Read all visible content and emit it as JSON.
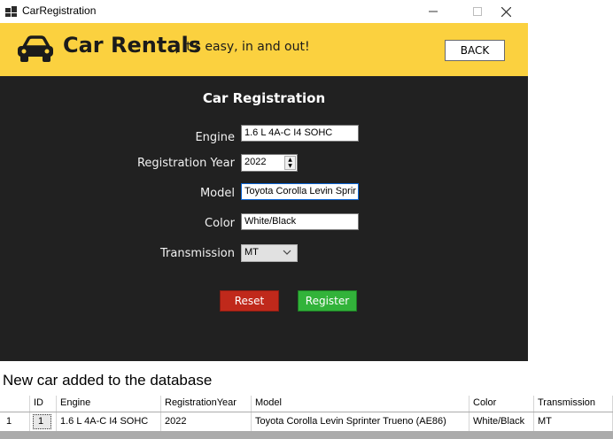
{
  "window": {
    "title": "CarRegistration",
    "controls": {
      "minimize": "minimize-icon",
      "maximize": "maximize-icon",
      "close": "close-icon"
    }
  },
  "banner": {
    "brand": "Car Rentals",
    "tagline": "| It's easy, in and out!",
    "back_label": "BACK",
    "color": "#fbd13f"
  },
  "form": {
    "title": "Car Registration",
    "engine": {
      "label": "Engine",
      "value": "1.6 L 4A-C I4 SOHC"
    },
    "year": {
      "label": "Registration Year",
      "value": "2022"
    },
    "model": {
      "label": "Model",
      "value": "Toyota Corolla Levin Sprir"
    },
    "color": {
      "label": "Color",
      "value": "White/Black"
    },
    "transmission": {
      "label": "Transmission",
      "value": "MT"
    },
    "reset_label": "Reset",
    "register_label": "Register",
    "panel_color": "#212121",
    "reset_color": "#c0291b",
    "register_color": "#32b33a"
  },
  "status": {
    "message": "New car added to the database"
  },
  "table": {
    "columns": [
      "ID",
      "Engine",
      "RegistrationYear",
      "Model",
      "Color",
      "Transmission"
    ],
    "rows": [
      {
        "row_number": "1",
        "cells": [
          "1",
          "1.6 L 4A-C I4 SOHC",
          "2022",
          "Toyota Corolla Levin Sprinter Trueno (AE86)",
          "White/Black",
          "MT"
        ]
      }
    ]
  }
}
